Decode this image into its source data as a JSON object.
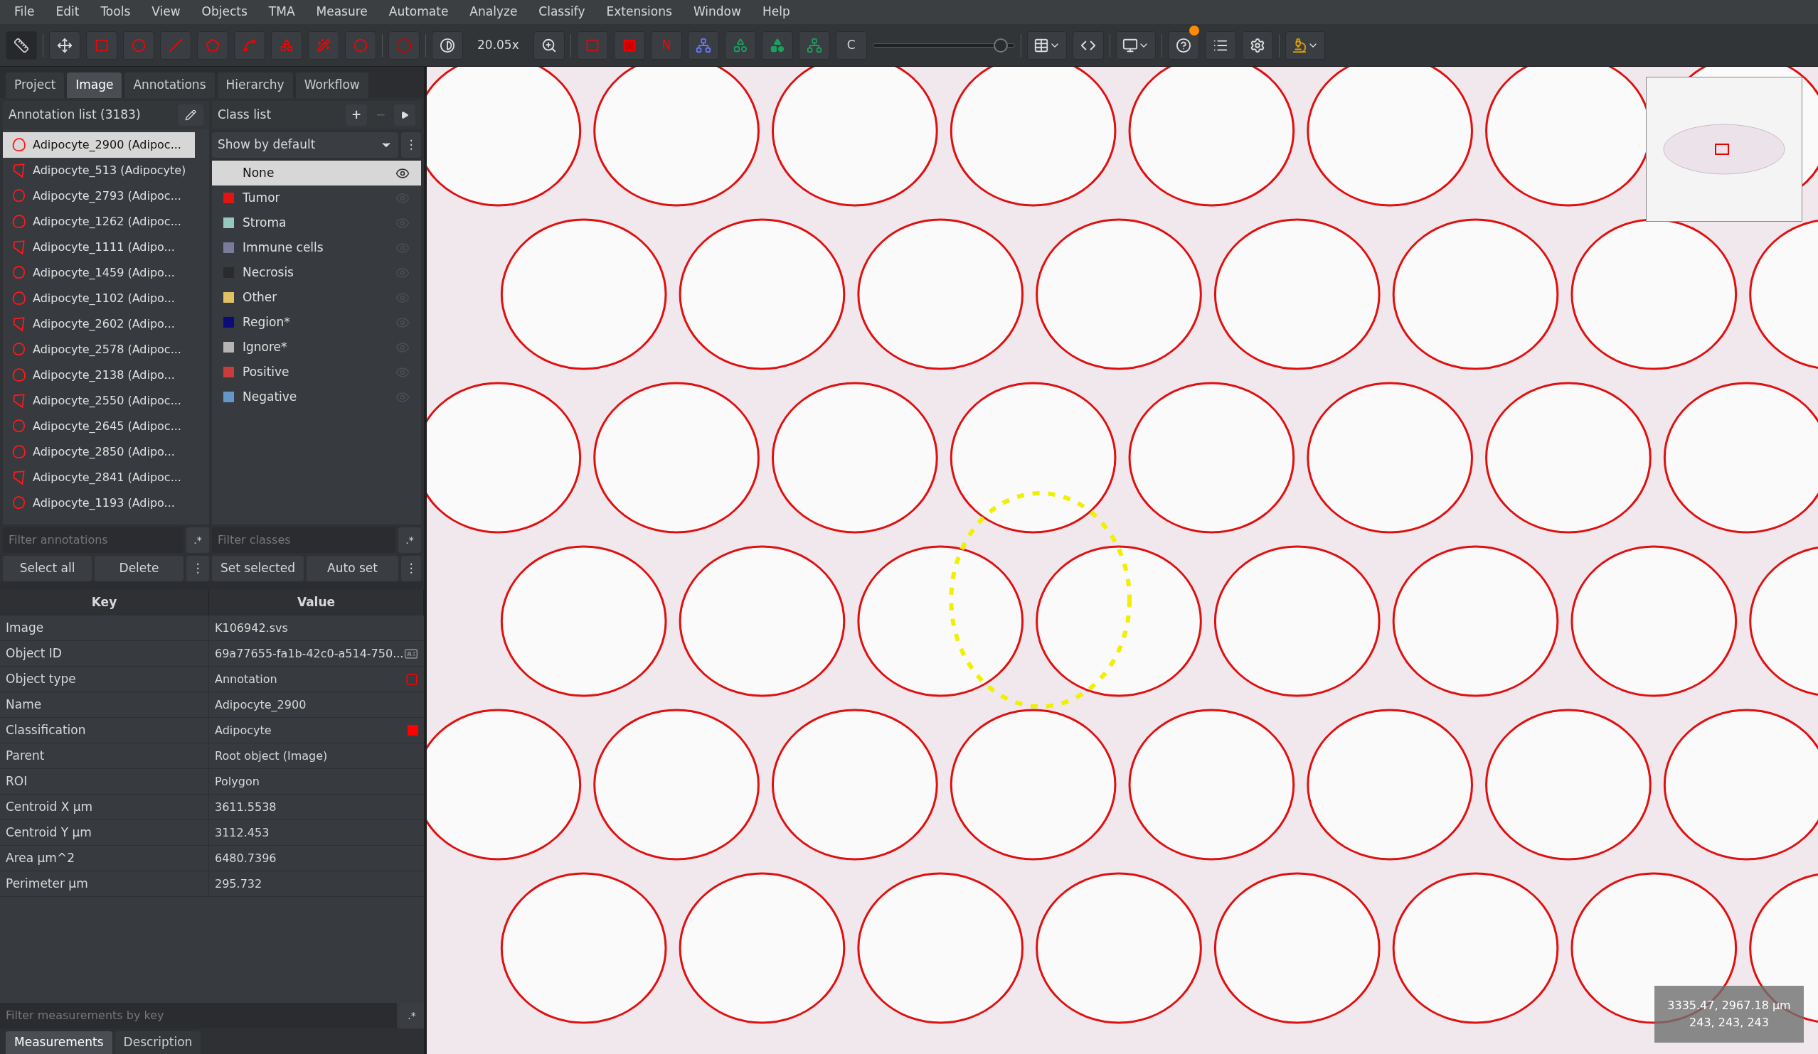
{
  "menu": [
    "File",
    "Edit",
    "Tools",
    "View",
    "Objects",
    "TMA",
    "Measure",
    "Automate",
    "Analyze",
    "Classify",
    "Extensions",
    "Window",
    "Help"
  ],
  "toolbar": {
    "zoom": "20.05x",
    "names_button": "N",
    "channel_button": "C",
    "opacity": {
      "level": 0.9
    },
    "notification": true
  },
  "tabs": [
    {
      "label": "Project",
      "selected": false
    },
    {
      "label": "Image",
      "selected": true
    },
    {
      "label": "Annotations",
      "selected": false
    },
    {
      "label": "Hierarchy",
      "selected": false
    },
    {
      "label": "Workflow",
      "selected": false
    }
  ],
  "annotation_list": {
    "title": "Annotation list (3183)",
    "items": [
      {
        "label": "Adipocyte_2900 (Adipoc...",
        "selected": true
      },
      {
        "label": "Adipocyte_513 (Adipocyte)",
        "selected": false
      },
      {
        "label": "Adipocyte_2793 (Adipoc...",
        "selected": false
      },
      {
        "label": "Adipocyte_1262 (Adipoc...",
        "selected": false
      },
      {
        "label": "Adipocyte_1111 (Adipo...",
        "selected": false
      },
      {
        "label": "Adipocyte_1459 (Adipo...",
        "selected": false
      },
      {
        "label": "Adipocyte_1102 (Adipo...",
        "selected": false
      },
      {
        "label": "Adipocyte_2602 (Adipo...",
        "selected": false
      },
      {
        "label": "Adipocyte_2578 (Adipoc...",
        "selected": false
      },
      {
        "label": "Adipocyte_2138 (Adipo...",
        "selected": false
      },
      {
        "label": "Adipocyte_2550 (Adipoc...",
        "selected": false
      },
      {
        "label": "Adipocyte_2645 (Adipoc...",
        "selected": false
      },
      {
        "label": "Adipocyte_2850 (Adipo...",
        "selected": false
      },
      {
        "label": "Adipocyte_2841 (Adipoc...",
        "selected": false
      },
      {
        "label": "Adipocyte_1193 (Adipo...",
        "selected": false
      }
    ],
    "filter_placeholder": "Filter annotations",
    "regex": ".*",
    "buttons": [
      "Select all",
      "Delete"
    ],
    "more": "⋮"
  },
  "class_list": {
    "title": "Class list",
    "add": "+",
    "remove": "−",
    "show_mode": "Show by default",
    "more": "⋮",
    "items": [
      {
        "label": "None",
        "selected": true
      },
      {
        "label": "Tumor",
        "color": "#e31414",
        "selected": false
      },
      {
        "label": "Stroma",
        "color": "#96c8c0",
        "selected": false
      },
      {
        "label": "Immune cells",
        "color": "#7a7a9c",
        "selected": false
      },
      {
        "label": "Necrosis",
        "color": "#2b2b2b",
        "selected": false
      },
      {
        "label": "Other",
        "color": "#e0c060",
        "selected": false
      },
      {
        "label": "Region*",
        "color": "#0c0c78",
        "selected": false
      },
      {
        "label": "Ignore*",
        "color": "#b4b4b4",
        "selected": false
      },
      {
        "label": "Positive",
        "color": "#c83c3c",
        "selected": false
      },
      {
        "label": "Negative",
        "color": "#6496c8",
        "selected": false
      }
    ],
    "filter_placeholder": "Filter classes",
    "regex": ".*",
    "buttons": [
      "Set selected",
      "Auto set"
    ]
  },
  "measurements": {
    "columns": [
      "Key",
      "Value"
    ],
    "rows": [
      {
        "key": "Image",
        "value": "K106942.svs"
      },
      {
        "key": "Object ID",
        "value": "69a77655-fa1b-42c0-a514-750...",
        "kind": "id"
      },
      {
        "key": "Object type",
        "value": "Annotation",
        "kind": "type"
      },
      {
        "key": "Name",
        "value": "Adipocyte_2900"
      },
      {
        "key": "Classification",
        "value": "Adipocyte",
        "kind": "class",
        "color": "#ff0000"
      },
      {
        "key": "Parent",
        "value": "Root object (Image)"
      },
      {
        "key": "ROI",
        "value": "Polygon"
      },
      {
        "key": "Centroid X µm",
        "value": "3611.5538"
      },
      {
        "key": "Centroid Y µm",
        "value": "3112.453"
      },
      {
        "key": "Area µm^2",
        "value": "6480.7396"
      },
      {
        "key": "Perimeter µm",
        "value": "295.732"
      }
    ],
    "filter_placeholder": "Filter measurements by key",
    "regex": ".*"
  },
  "bottom_tabs": [
    {
      "label": "Measurements",
      "selected": true
    },
    {
      "label": "Description",
      "selected": false
    }
  ],
  "viewer": {
    "cursor_position": "3335.47, 2967.18 µm",
    "pixel_value": "243, 243, 243"
  }
}
